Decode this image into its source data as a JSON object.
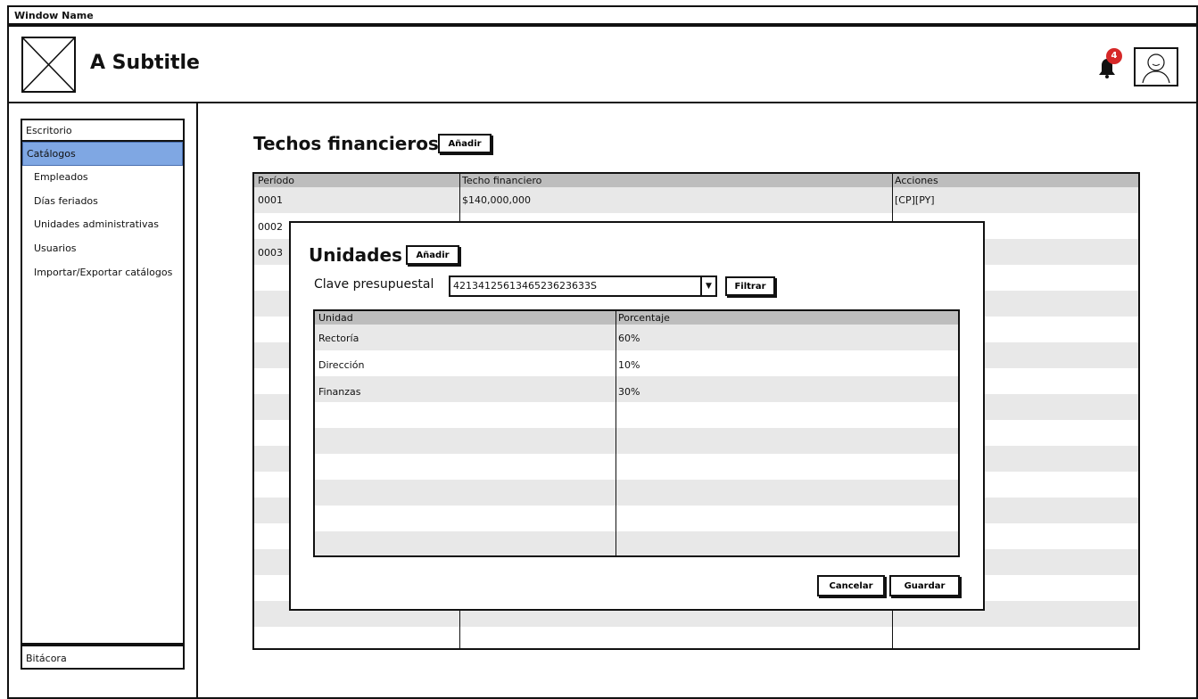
{
  "window": {
    "title": "Window Name"
  },
  "header": {
    "subtitle": "A Subtitle",
    "notifications_count": "4"
  },
  "sidebar": {
    "top_item": "Escritorio",
    "items": [
      {
        "label": "Catálogos",
        "selected": true
      },
      {
        "label": "Empleados"
      },
      {
        "label": "Días feriados"
      },
      {
        "label": "Unidades administrativas"
      },
      {
        "label": "Usuarios"
      },
      {
        "label": "Importar/Exportar catálogos"
      }
    ],
    "bottom_item": "Bitácora"
  },
  "main": {
    "title": "Techos financieros",
    "add_label": "Añadir",
    "table": {
      "columns": [
        "Período",
        "Techo financiero",
        "Acciones"
      ],
      "rows": [
        [
          "0001",
          "$140,000,000",
          "[CP][PY]"
        ],
        [
          "0002",
          "",
          ""
        ],
        [
          "0003",
          "",
          ""
        ]
      ]
    }
  },
  "modal": {
    "title": "Unidades",
    "add_label": "Añadir",
    "clave_label": "Clave presupuestal",
    "clave_value": "4213412561346523623633S",
    "filter_label": "Filtrar",
    "table": {
      "columns": [
        "Unidad",
        "Porcentaje"
      ],
      "rows": [
        [
          "Rectoría",
          "60%"
        ],
        [
          "Dirección",
          "10%"
        ],
        [
          "Finanzas",
          "30%"
        ]
      ]
    },
    "cancel_label": "Cancelar",
    "save_label": "Guardar"
  }
}
